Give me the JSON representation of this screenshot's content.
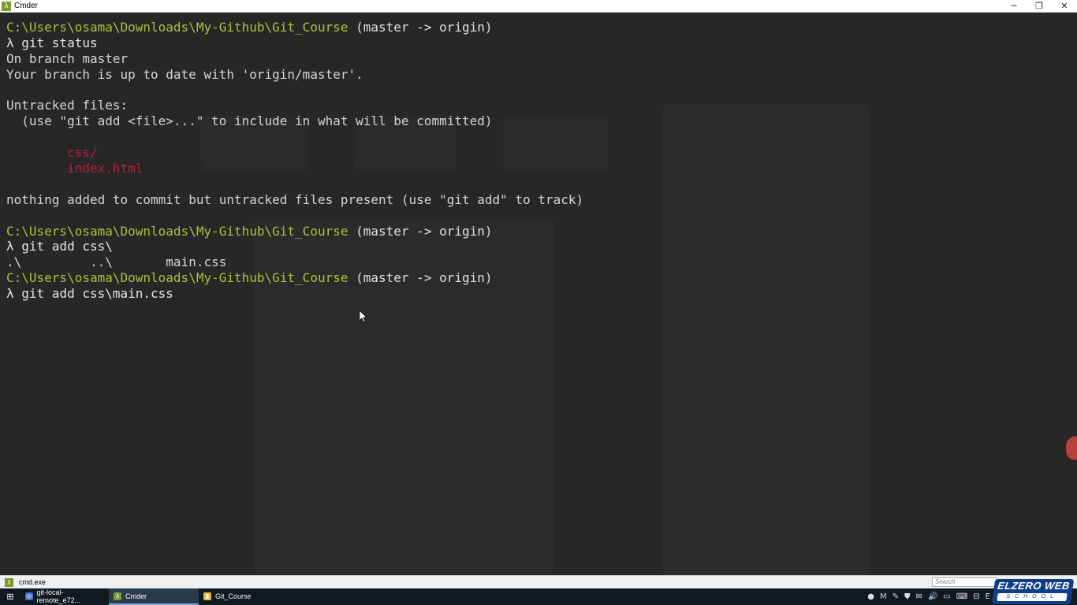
{
  "window": {
    "title": "Cmder",
    "app_icon": "λ",
    "minimize": "─",
    "restore": "❐",
    "close": "✕"
  },
  "terminal": {
    "lines": [
      {
        "kind": "prompt",
        "path": "C:\\Users\\osama\\Downloads\\My-Github\\Git_Course",
        "branch": " (master -> origin)"
      },
      {
        "kind": "cmd",
        "text": "λ git status"
      },
      {
        "kind": "out",
        "text": "On branch master"
      },
      {
        "kind": "out",
        "text": "Your branch is up to date with 'origin/master'."
      },
      {
        "kind": "out",
        "text": ""
      },
      {
        "kind": "out",
        "text": "Untracked files:"
      },
      {
        "kind": "out",
        "text": "  (use \"git add <file>...\" to include in what will be committed)"
      },
      {
        "kind": "out",
        "text": ""
      },
      {
        "kind": "untracked",
        "text": "        css/"
      },
      {
        "kind": "untracked",
        "text": "        index.html"
      },
      {
        "kind": "out",
        "text": ""
      },
      {
        "kind": "out",
        "text": "nothing added to commit but untracked files present (use \"git add\" to track)"
      },
      {
        "kind": "out",
        "text": ""
      },
      {
        "kind": "prompt",
        "path": "C:\\Users\\osama\\Downloads\\My-Github\\Git_Course",
        "branch": " (master -> origin)"
      },
      {
        "kind": "cmd",
        "text": "λ git add css\\"
      },
      {
        "kind": "out",
        "text": ".\\         ..\\       main.css"
      },
      {
        "kind": "prompt",
        "path": "C:\\Users\\osama\\Downloads\\My-Github\\Git_Course",
        "branch": " (master -> origin)"
      },
      {
        "kind": "cmd",
        "text": "λ git add css\\main.css"
      }
    ]
  },
  "statusbar": {
    "tab_icon": "λ",
    "tab_label": "cmd.exe",
    "search_placeholder": "Search"
  },
  "taskbar": {
    "start_icon": "⊞",
    "items": [
      {
        "label": "git-local-remote_e72...",
        "icon": "◎",
        "icon_color": "#3a6fc4",
        "active": false
      },
      {
        "label": "Cmder",
        "icon": "λ",
        "icon_color": "#7a9a2a",
        "active": true
      },
      {
        "label": "Git_Course",
        "icon": "▮",
        "icon_color": "#e8b84a",
        "active": false
      }
    ],
    "tray_icons": [
      "●",
      "M",
      "✎",
      "⛊",
      "✉",
      "🔊",
      "▭",
      "⌨",
      "⊟",
      "E"
    ]
  },
  "watermark": {
    "top": "ELZERO WEB",
    "bottom": "SCHOOL"
  }
}
